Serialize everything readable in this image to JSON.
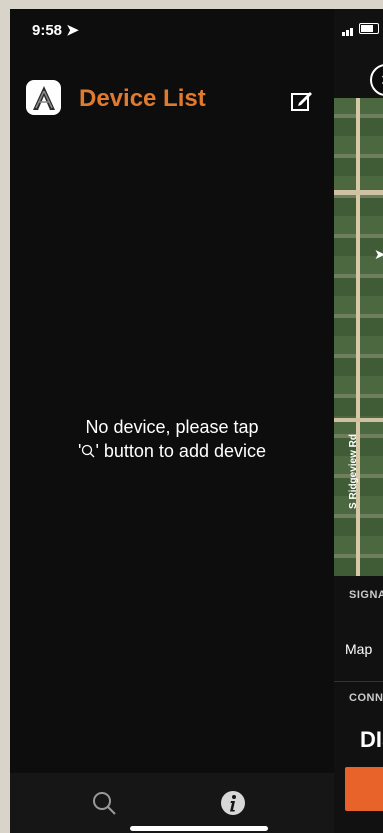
{
  "status": {
    "time": "9:58"
  },
  "header": {
    "title": "Device List"
  },
  "empty_state": {
    "line1": "No device, please tap",
    "line2_prefix": "'",
    "line2_suffix": "' button to add device"
  },
  "map_panel": {
    "road": "S Ridgeview Rd",
    "maps_brand": "Map",
    "signal_label": "SIGNA",
    "connection_label": "CONN",
    "status_text": "DIS"
  },
  "icons": [
    "edit-icon",
    "search-icon",
    "info-icon",
    "close-icon",
    "location-arrow-icon",
    "apple-logo-icon"
  ],
  "colors": {
    "accent": "#e07a2f",
    "button": "#e8632a",
    "background": "#0d0d0d"
  }
}
